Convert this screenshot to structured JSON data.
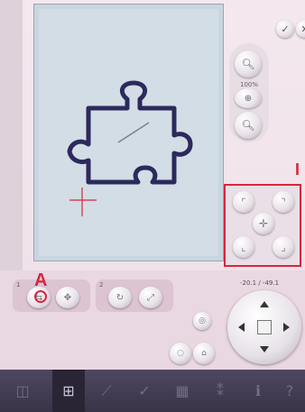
{
  "annotations": {
    "corner_panel_label": "I",
    "mode_label": "A"
  },
  "zoom": {
    "percent_label": "100%"
  },
  "mode_selector": {
    "group_1_number": "1",
    "group_2_number": "2"
  },
  "position": {
    "coordinates_label": "-20.1 / -49.1"
  },
  "colors": {
    "puzzle_stroke": "#2c2a5c",
    "annotation_red": "#d7263d",
    "taskbar": "#3f384d"
  },
  "icons": {
    "confirm": "checkmark-icon",
    "close": "close-icon",
    "zoom_in": "zoom-in-icon",
    "zoom_out": "zoom-out-icon",
    "zoom_all": "zoom-to-fit-icon"
  }
}
